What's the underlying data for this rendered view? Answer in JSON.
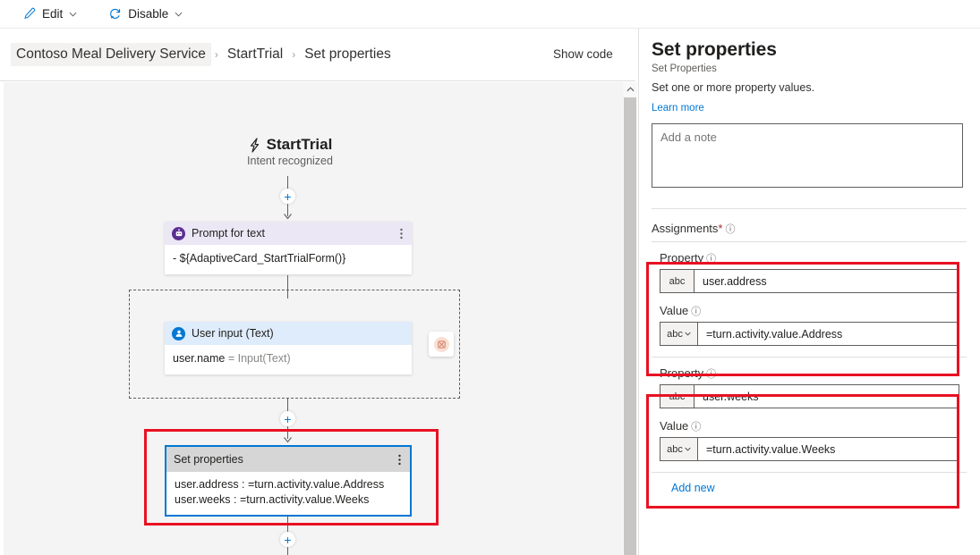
{
  "toolbar": {
    "edit": {
      "label": "Edit",
      "icon": "pencil-icon",
      "caret": "chevron-down-icon"
    },
    "disable": {
      "label": "Disable",
      "icon": "disable-circle-icon",
      "caret": "chevron-down-icon"
    }
  },
  "breadcrumb": {
    "items": [
      "Contoso Meal Delivery Service",
      "StartTrial",
      "Set properties"
    ],
    "separator": "›",
    "show_code": "Show code"
  },
  "canvas": {
    "trigger": {
      "title": "StartTrial",
      "subtitle": "Intent recognized",
      "icon": "lightning-bolt-icon"
    },
    "nodes": [
      {
        "id": "prompt-for-text",
        "title": "Prompt for text",
        "icon": "bot-icon",
        "body": [
          "- ${AdaptiveCard_StartTrialForm()}"
        ]
      },
      {
        "id": "user-input-text",
        "title": "User input (Text)",
        "icon": "person-icon",
        "body_prefix": "user.name ",
        "body_suffix": "= Input(Text)"
      },
      {
        "id": "set-properties",
        "title": "Set properties",
        "selected": true,
        "body": [
          "user.address : =turn.activity.value.Address",
          "user.weeks : =turn.activity.value.Weeks"
        ]
      }
    ],
    "add_button": "+",
    "loop_badge_icon": "loop-stop-icon",
    "menu_icon": "more-vertical-icon"
  },
  "panel": {
    "title": "Set properties",
    "subtitle": "Set Properties",
    "description": "Set one or more property values.",
    "learn_more": "Learn more",
    "note_placeholder": "Add a note",
    "note_value": "",
    "assignments_label": "Assignments",
    "required_marker": "*",
    "info_icon": "ⓘ",
    "assignments": [
      {
        "property_label": "Property",
        "property_type": "abc",
        "property_value": "user.address",
        "value_label": "Value",
        "value_type": "abc",
        "value_value": "=turn.activity.value.Address"
      },
      {
        "property_label": "Property",
        "property_type": "abc",
        "property_value": "user.weeks",
        "value_label": "Value",
        "value_type": "abc",
        "value_value": "=turn.activity.value.Weeks"
      }
    ],
    "add_new": "Add new"
  },
  "colors": {
    "accent": "#0078d4",
    "annotation_red": "#e81123",
    "prompt_purple": "#5c2e91",
    "canvas_bg": "#f4f4f4"
  }
}
